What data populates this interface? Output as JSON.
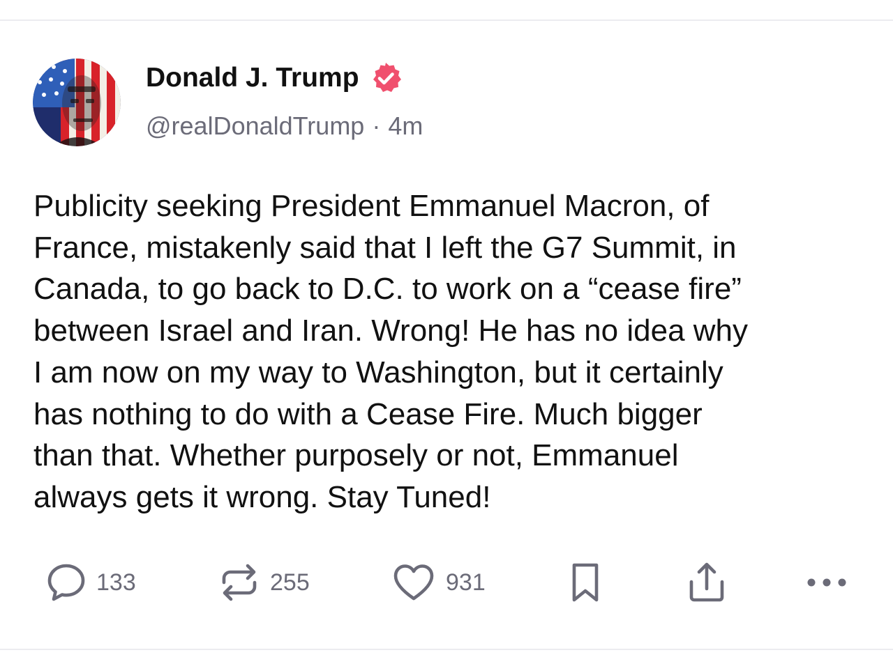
{
  "post": {
    "author": {
      "display_name": "Donald J. Trump",
      "handle": "@realDonaldTrump",
      "verified": true
    },
    "separator": "·",
    "timestamp": "4m",
    "body_lines": [
      "Publicity seeking President Emmanuel Macron, of",
      "France, mistakenly said that I left the G7 Summit, in",
      "Canada, to go back to D.C. to work on a “cease fire”",
      "between Israel and Iran. Wrong! He has no idea why",
      "I am now on my way to Washington, but it certainly",
      "has nothing to do with a Cease Fire. Much bigger",
      "than that. Whether purposely or not, Emmanuel",
      "always gets it wrong. Stay Tuned!"
    ],
    "actions": {
      "reply_count": "133",
      "repost_count": "255",
      "like_count": "931"
    }
  },
  "icons": {
    "verified": "verified-badge-icon",
    "reply": "speech-bubble-icon",
    "repost": "repost-arrows-icon",
    "like": "heart-icon",
    "bookmark": "bookmark-icon",
    "share": "share-upload-icon",
    "more": "more-dots-icon"
  },
  "colors": {
    "background": "#ffffff",
    "text": "#111111",
    "secondary_text": "#6b6b78",
    "verified_badge": "#f0506e",
    "divider": "#ececf0"
  }
}
